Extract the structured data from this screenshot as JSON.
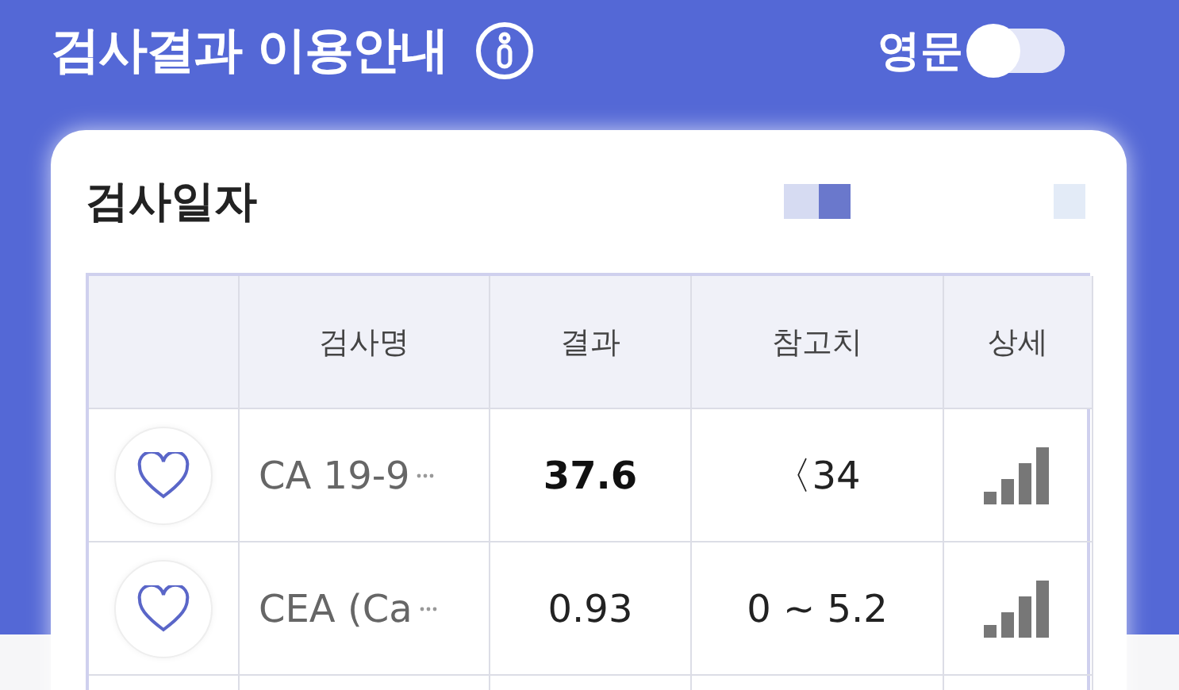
{
  "header": {
    "title": "검사결과 이용안내",
    "english_toggle": {
      "label": "영문",
      "on": false
    }
  },
  "card": {
    "title": "검사일자"
  },
  "table": {
    "columns": [
      "검사명",
      "결과",
      "참고치",
      "상세"
    ],
    "rows": [
      {
        "name": "CA 19-9",
        "result": "37.6",
        "abnormal": true,
        "reference": "〈34",
        "favorite": false
      },
      {
        "name": "CEA (Ca",
        "result": "0.93",
        "abnormal": false,
        "reference": "0 ~ 5.2",
        "favorite": false
      }
    ]
  }
}
